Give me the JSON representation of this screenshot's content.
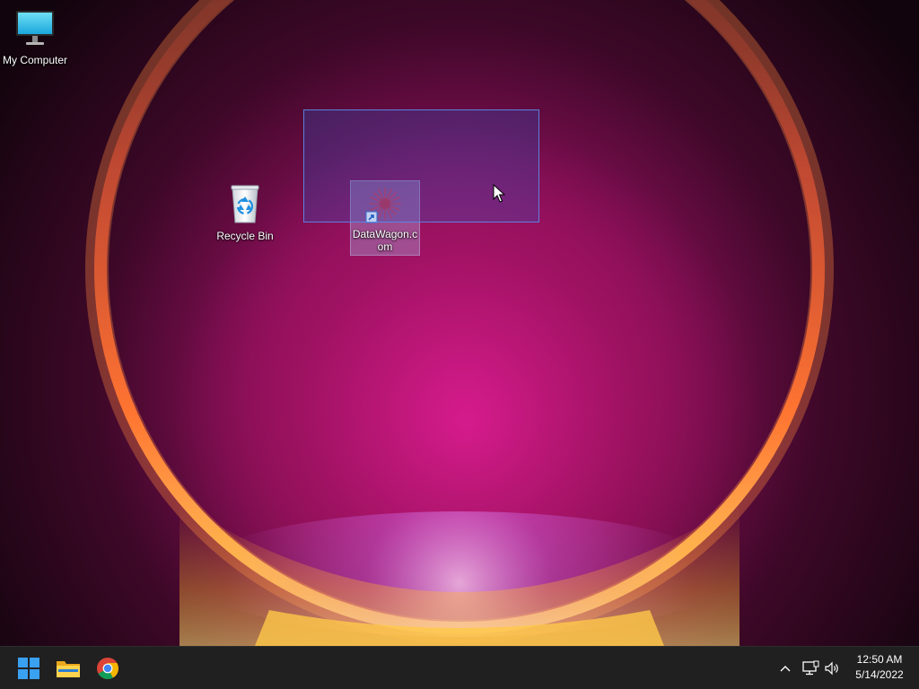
{
  "desktop": {
    "icons": [
      {
        "label": "My Computer",
        "icon": "monitor-icon"
      },
      {
        "label": "Recycle Bin",
        "icon": "recycle-bin-icon"
      },
      {
        "label": "DataWagon.com",
        "icon": "shortcut-icon",
        "selected": true
      }
    ]
  },
  "taskbar": {
    "apps": [
      {
        "icon": "windows-start-icon"
      },
      {
        "icon": "folder-icon"
      },
      {
        "icon": "chrome-icon"
      }
    ],
    "tray": {
      "icons": [
        "chevron-up-icon",
        "network-icon",
        "volume-icon"
      ],
      "time": "12:50 AM",
      "date": "5/14/2022"
    }
  },
  "colors": {
    "taskbar_bg": "#202020",
    "selection_fill": "#285ac8",
    "selection_border": "#5a8ceb",
    "start_blue": "#3aa0f0"
  }
}
